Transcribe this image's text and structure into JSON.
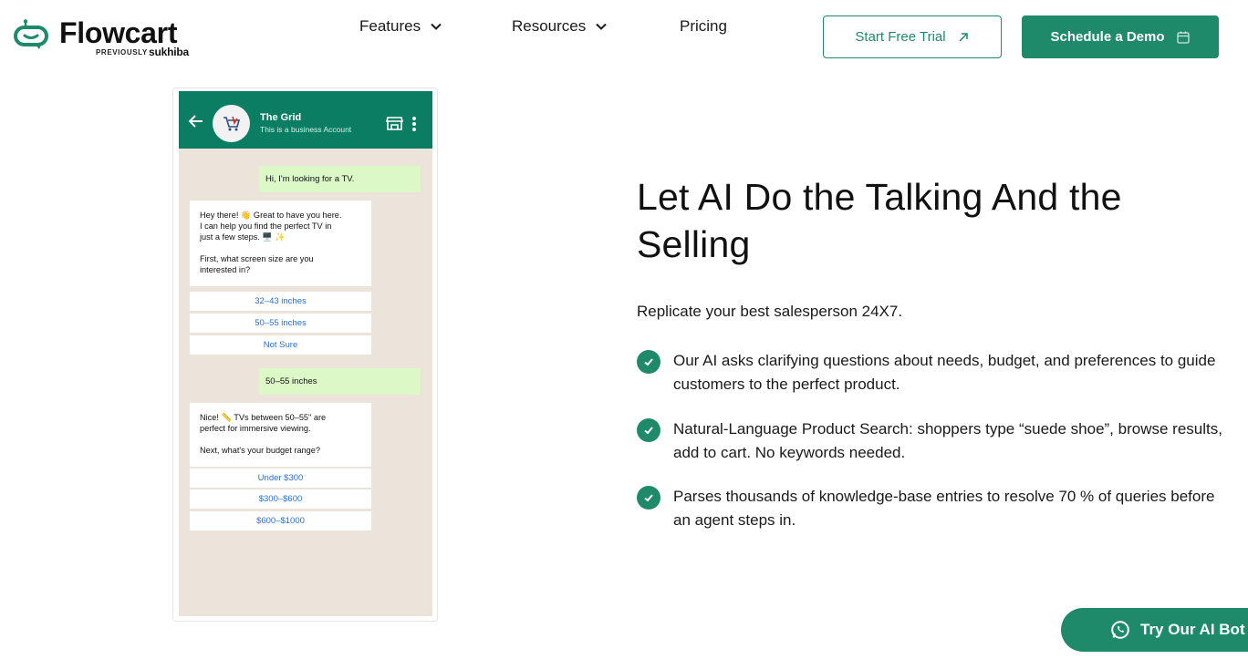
{
  "brand": {
    "name": "Flowcart",
    "previously_label": "PREVIOUSLY",
    "previous_name": "sukhiba",
    "accent": "#1f8a6a"
  },
  "nav": {
    "items": [
      {
        "label": "Features",
        "has_dropdown": true
      },
      {
        "label": "Resources",
        "has_dropdown": true
      },
      {
        "label": "Pricing",
        "has_dropdown": false
      }
    ]
  },
  "header_buttons": {
    "trial_label": "Start Free Trial",
    "demo_label": "Schedule a Demo"
  },
  "chat": {
    "contact_name": "The Grid",
    "contact_sub": "This is a business Account",
    "header_color": "#0b7d62",
    "messages": [
      {
        "from": "user",
        "text": "Hi, I'm looking for a TV."
      },
      {
        "from": "bot",
        "text": "Hey there! 👋 Great to have you here.\nI can help you find the perfect TV in\njust a few steps. 🖥️ ✨\n\nFirst, what screen size are you\ninterested in?"
      },
      {
        "from": "user",
        "text": "50–55 inches"
      },
      {
        "from": "bot",
        "text": "Nice! 📏 TVs between 50–55\" are\nperfect for immersive viewing.\n\nNext, what's your budget range?"
      }
    ],
    "quick_replies_size": [
      "32–43 inches",
      "50–55 inches",
      "Not Sure"
    ],
    "quick_replies_budget": [
      "Under $300",
      "$300–$600",
      "$600–$1000"
    ]
  },
  "hero": {
    "headline": "Let AI Do the Talking And the Selling",
    "subline": "Replicate your best salesperson 24X7.",
    "features": [
      "Our AI asks clarifying questions about needs, budget, and preferences to guide customers to the perfect product.",
      "Natural-Language Product Search: shoppers type “suede shoe”, browse results, add to cart. No keywords needed.",
      "Parses thousands of knowledge-base entries to resolve 70 % of queries before an agent steps in."
    ]
  },
  "floating": {
    "try_bot_label": "Try Our AI Bot"
  }
}
